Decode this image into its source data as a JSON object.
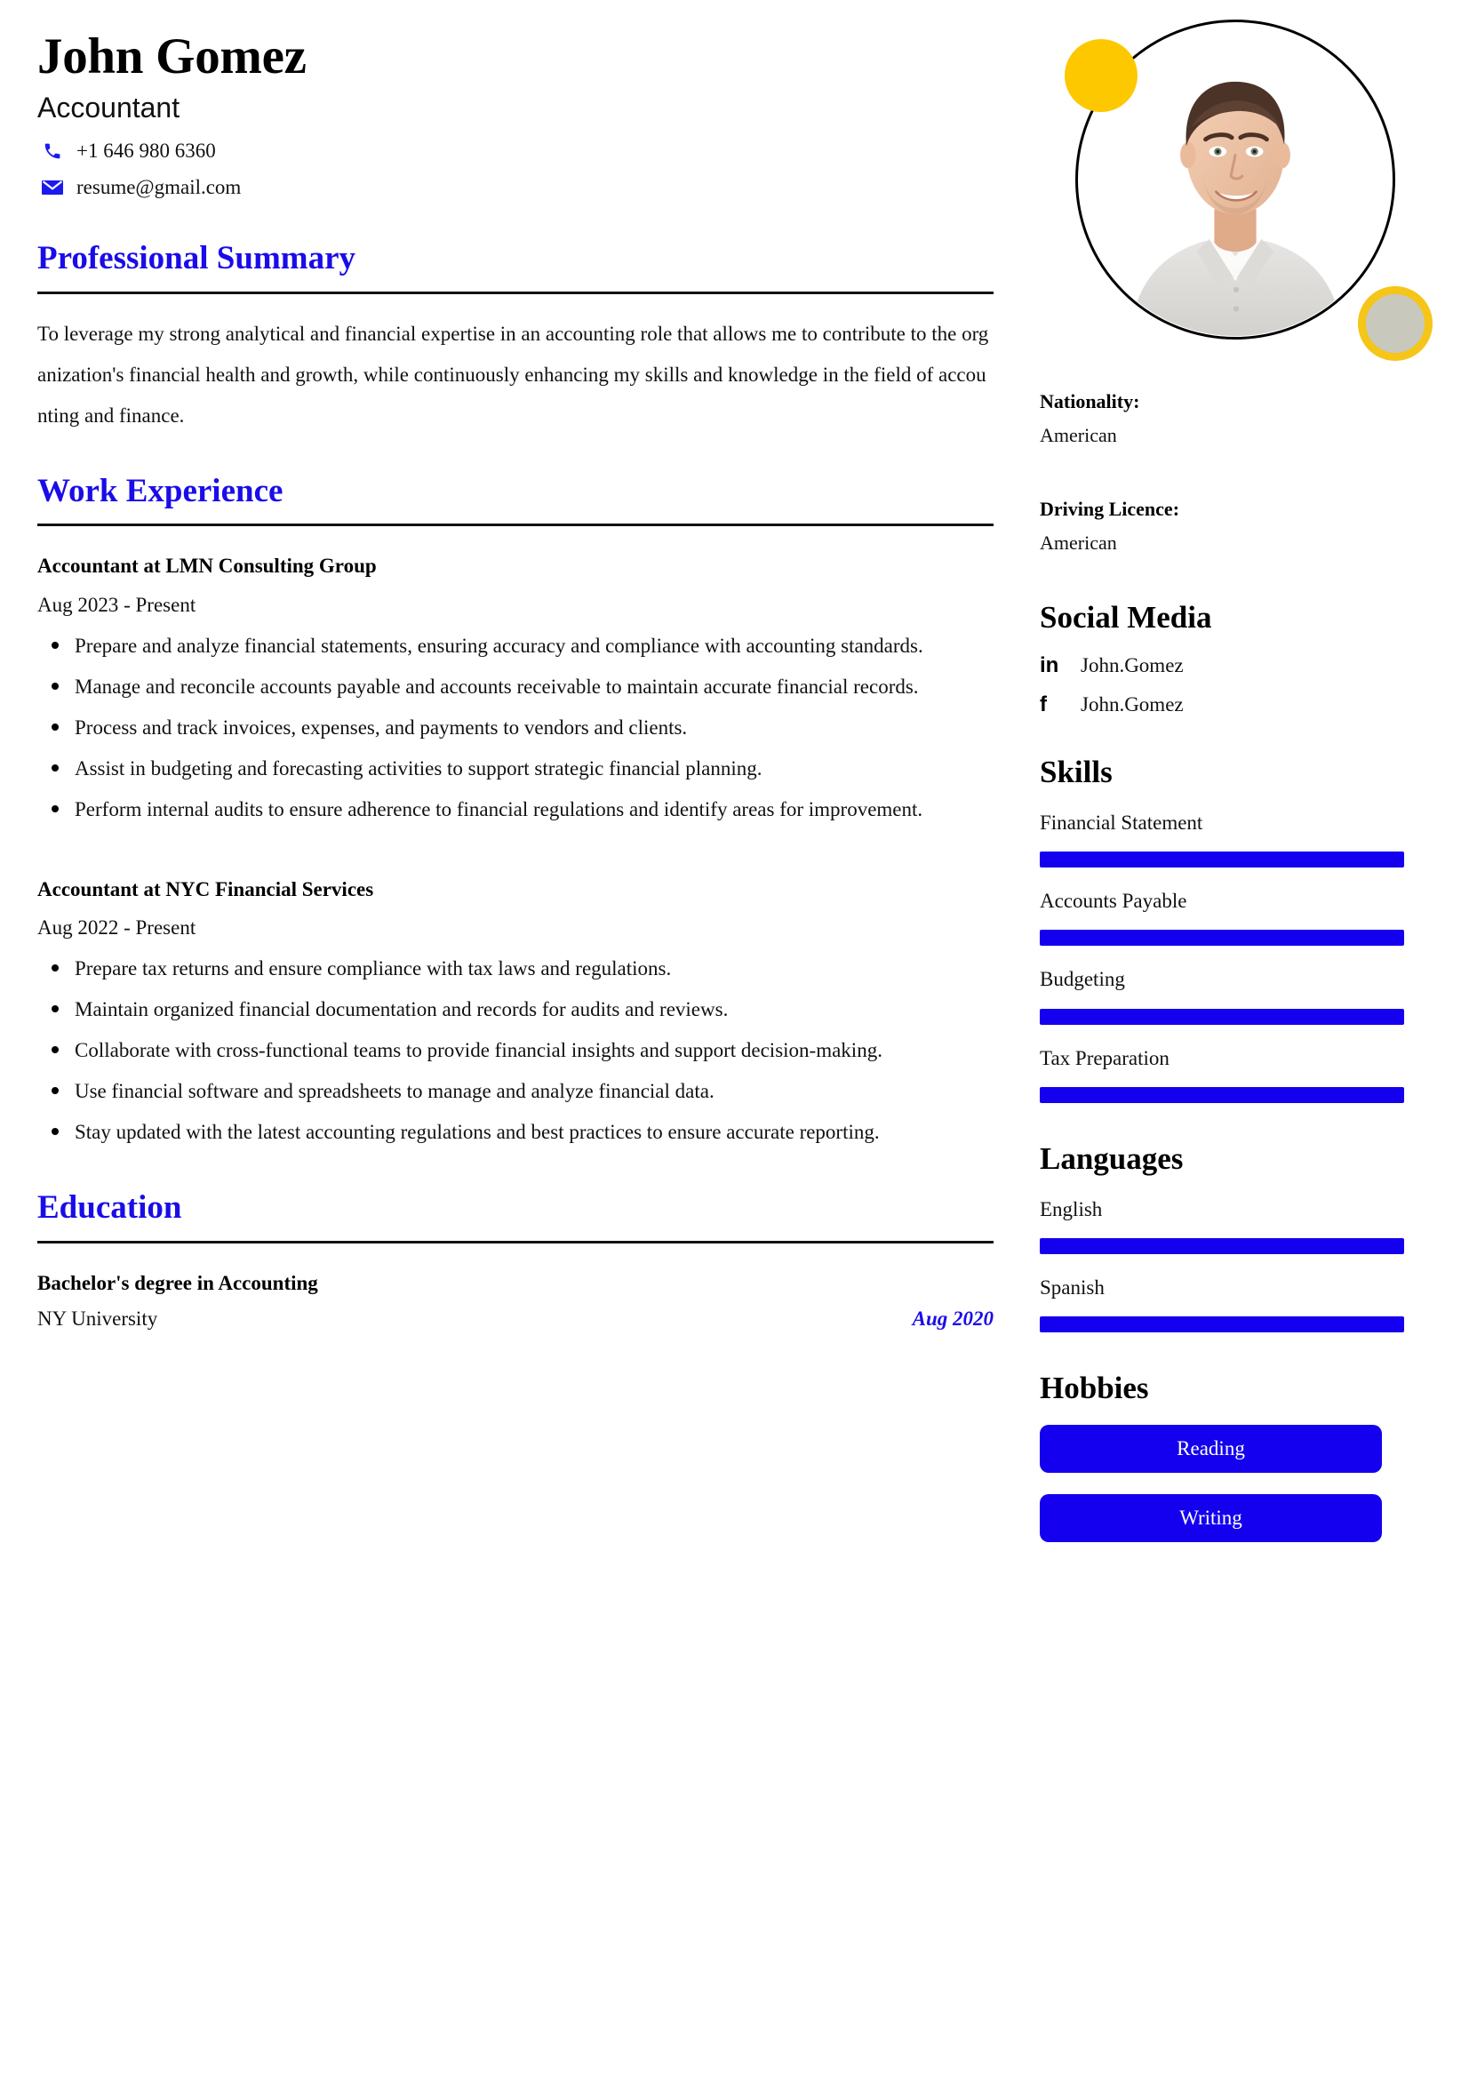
{
  "header": {
    "name": "John Gomez",
    "title": "Accountant",
    "phone": "+1 646 980 6360",
    "email": "resume@gmail.com",
    "phone_icon": "phone-icon",
    "email_icon": "envelope-icon"
  },
  "colors": {
    "accent_blue": "#1a0ce8",
    "bar_blue": "#1400ee",
    "deco_yellow": "#fdc800",
    "deco_grey": "#c9c8bd",
    "text": "#111111"
  },
  "sections": {
    "summary_heading": "Professional Summary",
    "summary_text": "To leverage my strong analytical and financial expertise in an accounting role that allows me to contribute to the organization's financial health and growth, while continuously enhancing my skills and knowledge in the field of accounting and finance.",
    "experience_heading": "Work Experience",
    "education_heading": "Education"
  },
  "experience": [
    {
      "role": "Accountant at LMN Consulting Group",
      "dates": "Aug 2023 - Present",
      "bullets": [
        "Prepare and analyze financial statements, ensuring accuracy and compliance with accounting standards.",
        "Manage and reconcile accounts payable and accounts receivable to maintain accurate financial records.",
        "Process and track invoices, expenses, and payments to vendors and clients.",
        "Assist in budgeting and forecasting activities to support strategic financial planning.",
        "Perform internal audits to ensure adherence to financial regulations and identify areas for improvement."
      ]
    },
    {
      "role": "Accountant at NYC Financial Services",
      "dates": "Aug 2022 - Present",
      "bullets": [
        "Prepare tax returns and ensure compliance with tax laws and regulations.",
        "Maintain organized financial documentation and records for audits and reviews.",
        "Collaborate with cross-functional teams to provide financial insights and support decision-making.",
        "Use financial software and spreadsheets to manage and analyze financial data.",
        "Stay updated with the latest accounting regulations and best practices to ensure accurate reporting."
      ]
    }
  ],
  "education": [
    {
      "degree": "Bachelor's degree in Accounting",
      "school": "NY University",
      "date": "Aug 2020"
    }
  ],
  "sidebar": {
    "nationality_label": "Nationality:",
    "nationality_value": "American",
    "driving_label": "Driving Licence:",
    "driving_value": "American",
    "social_heading": "Social Media",
    "social": [
      {
        "icon": "linkedin-icon",
        "glyph": "in",
        "name": "John.Gomez"
      },
      {
        "icon": "facebook-icon",
        "glyph": "f",
        "name": "John.Gomez"
      }
    ],
    "skills_heading": "Skills",
    "skills": [
      {
        "label": "Financial Statement",
        "level": 100
      },
      {
        "label": "Accounts Payable",
        "level": 100
      },
      {
        "label": "Budgeting",
        "level": 100
      },
      {
        "label": "Tax Preparation",
        "level": 100
      }
    ],
    "languages_heading": "Languages",
    "languages": [
      {
        "label": "English",
        "level": 100
      },
      {
        "label": "Spanish",
        "level": 100
      }
    ],
    "hobbies_heading": "Hobbies",
    "hobbies": [
      {
        "label": "Reading"
      },
      {
        "label": "Writing"
      }
    ]
  }
}
